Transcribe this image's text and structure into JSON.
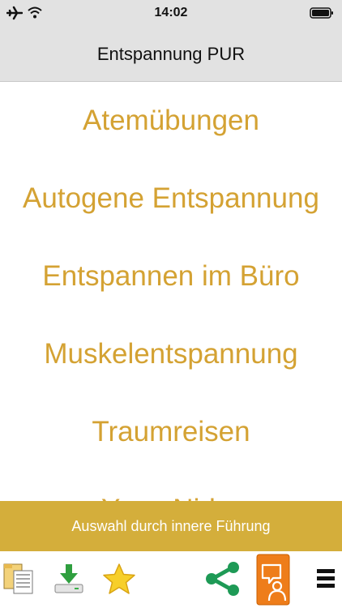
{
  "status_bar": {
    "time": "14:02"
  },
  "header": {
    "title": "Entspannung PUR"
  },
  "list": {
    "items": [
      "Atemübungen",
      "Autogene Entspannung",
      "Entspannen im Büro",
      "Muskelentspannung",
      "Traumreisen",
      "Yoga Nidra"
    ]
  },
  "banner": {
    "label": "Auswahl durch innere Führung"
  },
  "toolbar": {
    "icons": [
      "folder-icon",
      "download-icon",
      "star-icon",
      "share-icon",
      "guidance-icon",
      "menu-icon"
    ]
  },
  "colors": {
    "header_bg": "#e2e2e2",
    "list_text": "#d4a233",
    "banner_bg": "#d4ae3b",
    "share_green": "#1e9a56",
    "guidance_orange": "#ee7d1a"
  }
}
